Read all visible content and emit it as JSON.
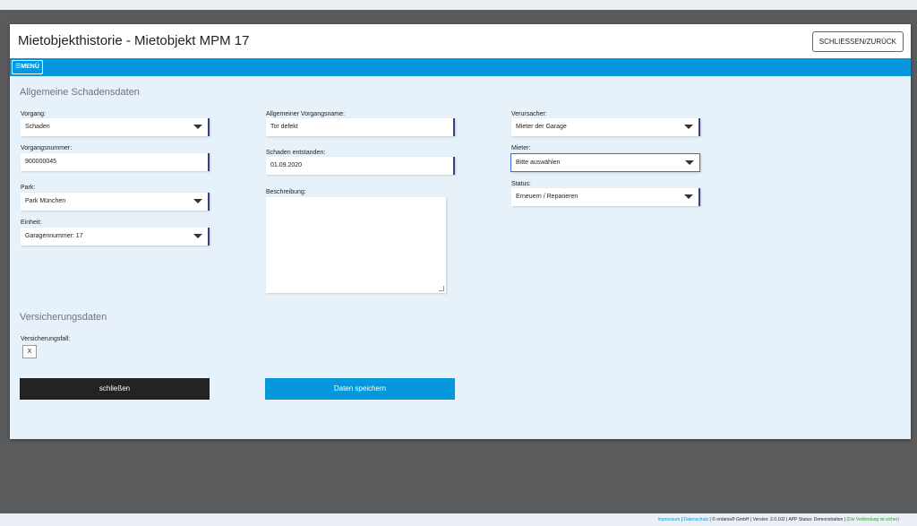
{
  "window": {
    "title": "Mietobjekthistorie - Mietobjekt MPM 17",
    "close_label": "SCHLIESSEN/ZURÜCK"
  },
  "menu": {
    "label": "MENÜ"
  },
  "sections": {
    "damage": "Allgemeine Schadensdaten",
    "insurance": "Versicherungsdaten"
  },
  "form": {
    "vorgang": {
      "label": "Vorgang:",
      "value": "Schaden"
    },
    "vorgangsnummer": {
      "label": "Vorgangsnummer:",
      "value": "900000045"
    },
    "park": {
      "label": "Park:",
      "value": "Park München"
    },
    "einheit": {
      "label": "Einheit:",
      "value": "Garagennummer: 17"
    },
    "vorgangsname": {
      "label": "Allgemeiner Vorgangsname:",
      "value": "Tor defekt"
    },
    "entstanden": {
      "label": "Schaden entstanden:",
      "value": "01.09.2020"
    },
    "beschreibung": {
      "label": "Beschreibung:",
      "value": ""
    },
    "verursacher": {
      "label": "Verursacher:",
      "value": "Mieter der Garage"
    },
    "mieter": {
      "label": "Mieter:",
      "value": "Bitte auswählen"
    },
    "status": {
      "label": "Status:",
      "value": "Erneuern / Reparieren"
    },
    "versicherungsfall": {
      "label": "Versicherungsfall:",
      "value": "X"
    }
  },
  "buttons": {
    "close": "schließen",
    "save": "Daten speichern"
  },
  "footer": {
    "impressum": "Impressum",
    "sep1": " | ",
    "datenschutz": "Datenschutz",
    "rest": " | © ordania® GmbH | Version: 2.0.102 | APP Status: Demonstration | ",
    "secure": "(Die Verbindung ist sicher)"
  },
  "colors": {
    "accent": "#0497dc",
    "dark_button": "#232323",
    "background": "#e6f1f9"
  }
}
